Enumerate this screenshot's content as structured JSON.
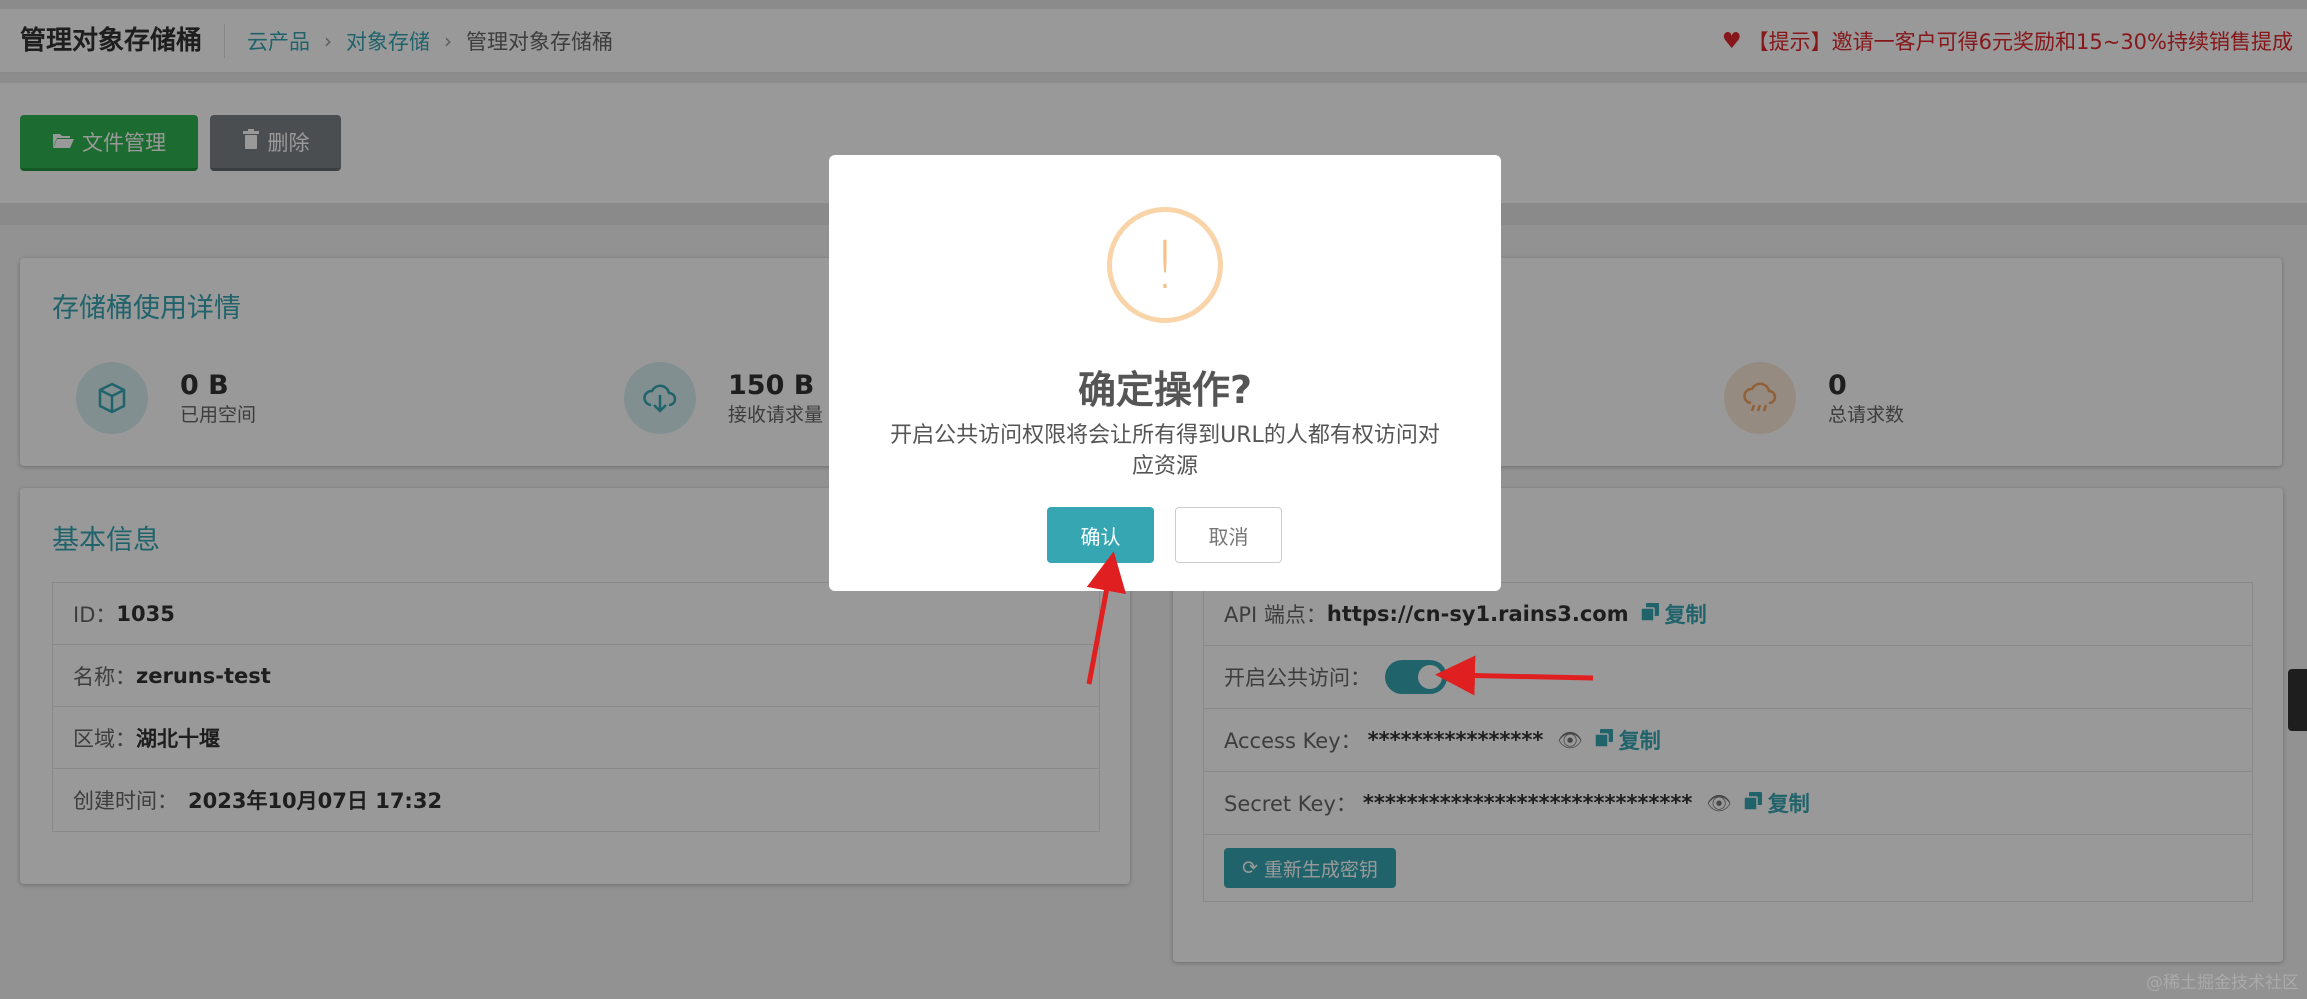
{
  "header": {
    "title": "管理对象存储桶",
    "breadcrumb": [
      "云产品",
      "对象存储",
      "管理对象存储桶"
    ],
    "promo": "【提示】邀请一客户可得6元奖励和15~30%持续销售提成"
  },
  "toolbar": {
    "files_label": "文件管理",
    "delete_label": "删除"
  },
  "usage": {
    "title": "存储桶使用详情",
    "stats": [
      {
        "value": "0 B",
        "label": "已用空间",
        "icon": "cube-icon",
        "color": "#36a6b3"
      },
      {
        "value": "150 B",
        "label": "接收请求量",
        "icon": "cloud-download-icon",
        "color": "#36a6b3"
      },
      {
        "value": "0",
        "label": "总请求数",
        "icon": "cloud-rain-icon",
        "color": "#f0a060"
      }
    ]
  },
  "basic": {
    "title": "基本信息",
    "rows": [
      {
        "key": "ID：",
        "value": "1035"
      },
      {
        "key": "名称：",
        "value": "zeruns-test"
      },
      {
        "key": "区域：",
        "value": "湖北十堰"
      },
      {
        "key": "创建时间：",
        "value": "2023年10月07日 17:32"
      }
    ]
  },
  "access": {
    "endpoint_label": "API 端点：",
    "endpoint_value": "https://cn-sy1.rains3.com",
    "public_label": "开启公共访问：",
    "public_enabled": true,
    "access_key_label": "Access Key：",
    "access_key_value": "****************",
    "secret_key_label": "Secret Key：",
    "secret_key_value": "******************************",
    "copy_label": "复制",
    "regen_label": "重新生成密钥"
  },
  "modal": {
    "icon": "!",
    "title": "确定操作?",
    "message": "开启公共访问权限将会让所有得到URL的人都有权访问对应资源",
    "confirm_label": "确认",
    "cancel_label": "取消"
  },
  "watermark": "@稀土掘金技术社区",
  "colors": {
    "accent": "#36a6b3",
    "success": "#2fb350",
    "danger": "#e0282e",
    "arrow": "#e02020"
  }
}
